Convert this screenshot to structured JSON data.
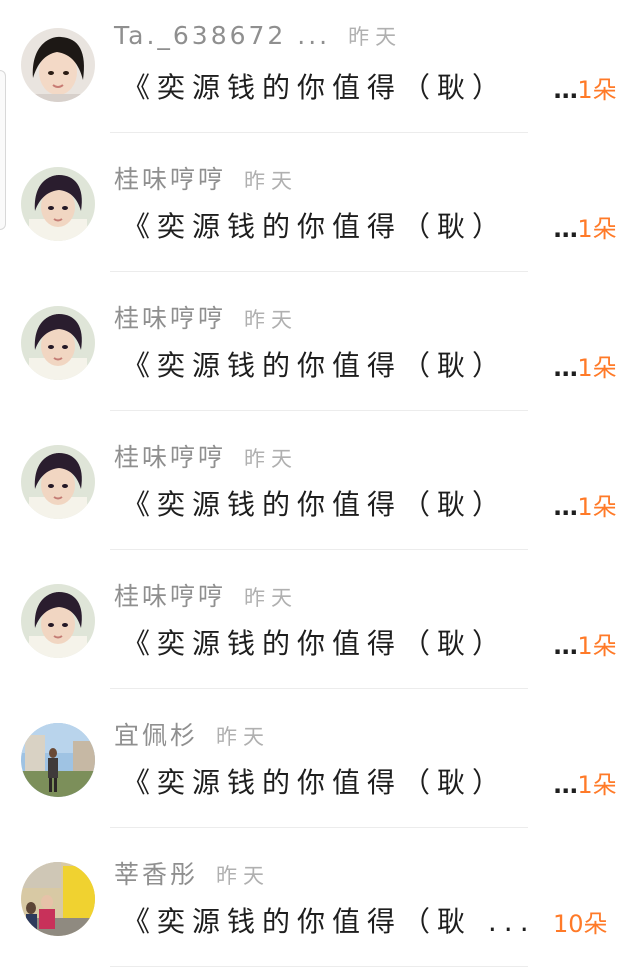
{
  "comments": [
    {
      "avatar": "avatar-girl",
      "name": "Ta._638672 ...",
      "time": "昨天",
      "message": "《奕源钱的你值得（耿）",
      "ellipsis": "...",
      "flowers": "1朵"
    },
    {
      "avatar": "avatar-boy",
      "name": "桂味哼哼",
      "time": "昨天",
      "message": "《奕源钱的你值得（耿）",
      "ellipsis": "...",
      "flowers": "1朵"
    },
    {
      "avatar": "avatar-boy",
      "name": "桂味哼哼",
      "time": "昨天",
      "message": "《奕源钱的你值得（耿）",
      "ellipsis": "...",
      "flowers": "1朵"
    },
    {
      "avatar": "avatar-boy",
      "name": "桂味哼哼",
      "time": "昨天",
      "message": "《奕源钱的你值得（耿）",
      "ellipsis": "...",
      "flowers": "1朵"
    },
    {
      "avatar": "avatar-boy",
      "name": "桂味哼哼",
      "time": "昨天",
      "message": "《奕源钱的你值得（耿）",
      "ellipsis": "...",
      "flowers": "1朵"
    },
    {
      "avatar": "avatar-street",
      "name": "宜佩杉",
      "time": "昨天",
      "message": "《奕源钱的你值得（耿）",
      "ellipsis": "...",
      "flowers": "1朵"
    },
    {
      "avatar": "avatar-child",
      "name": "莘香彤",
      "time": "昨天",
      "message": "《奕源钱的你值得（耿 ...",
      "ellipsis": "",
      "flowers": "10朵"
    }
  ]
}
